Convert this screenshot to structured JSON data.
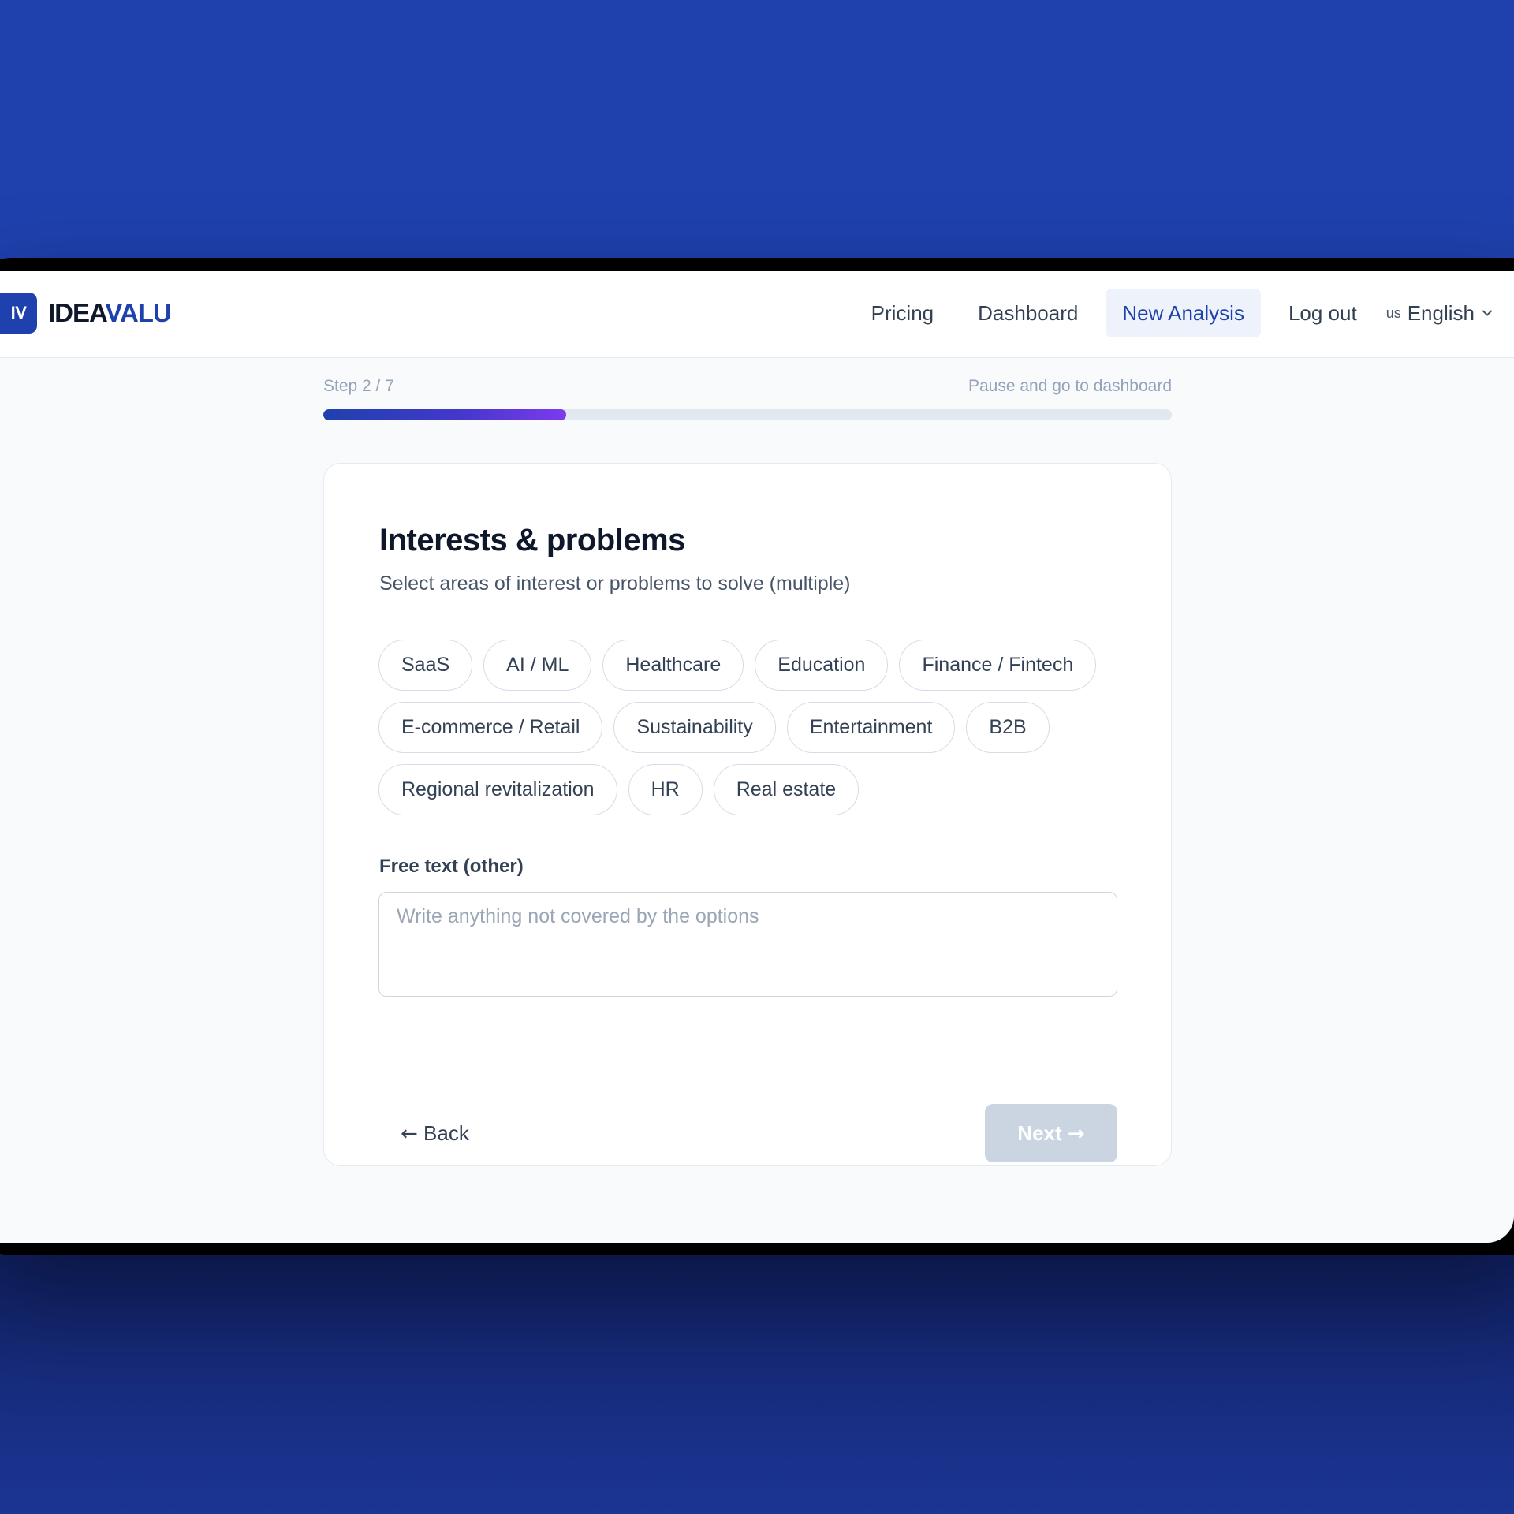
{
  "brand": {
    "badge": "IV",
    "name_part1": "IDEA",
    "name_part2": "VALU"
  },
  "nav": {
    "items": [
      {
        "label": "Pricing",
        "active": false
      },
      {
        "label": "Dashboard",
        "active": false
      },
      {
        "label": "New Analysis",
        "active": true
      },
      {
        "label": "Log out",
        "active": false
      }
    ],
    "language": {
      "flag": "us",
      "label": "English",
      "icon": "chevron-down-icon"
    }
  },
  "progress": {
    "step_label": "Step 2 / 7",
    "pause_label": "Pause and go to dashboard",
    "fraction": 0.286
  },
  "form": {
    "title": "Interests & problems",
    "subtitle": "Select areas of interest or problems to solve (multiple)",
    "options": [
      "SaaS",
      "AI / ML",
      "Healthcare",
      "Education",
      "Finance / Fintech",
      "E-commerce / Retail",
      "Sustainability",
      "Entertainment",
      "B2B",
      "Regional revitalization",
      "HR",
      "Real estate"
    ],
    "free_text_label": "Free text (other)",
    "free_text_placeholder": "Write anything not covered by the options",
    "free_text_value": "",
    "back_label": "Back",
    "next_label": "Next",
    "next_enabled": false
  },
  "colors": {
    "background": "#1f41ad",
    "accent": "#1f41ad",
    "progress_end": "#7c3aed",
    "next_disabled": "#cbd5e1"
  }
}
